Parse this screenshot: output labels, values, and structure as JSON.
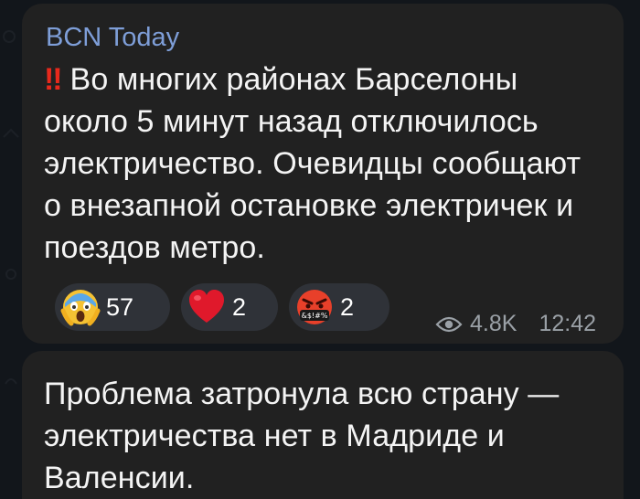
{
  "channel": {
    "name": "BCN Today"
  },
  "messages": [
    {
      "alert_marker": "‼",
      "text": "Во многих районах Барселоны около 5 минут назад отключилось электричество. Очевидцы сообщают о внезапной остановке электричек и поездов метро.",
      "reactions": [
        {
          "icon": "scream-face-icon",
          "count": "57"
        },
        {
          "icon": "red-heart-icon",
          "count": "2"
        },
        {
          "icon": "cursing-face-icon",
          "count": "2",
          "emoji_label": "&$!#%"
        }
      ],
      "views": "4.8K",
      "time": "12:42"
    },
    {
      "text": "Проблема затронула всю страну — электричества нет в Мадриде и Валенсии."
    }
  ],
  "colors": {
    "bubble": "#212121",
    "sender": "#7e9ed8",
    "alert": "#e8291c",
    "reaction_bg": "#2f3238",
    "meta": "#9aa0a6"
  }
}
